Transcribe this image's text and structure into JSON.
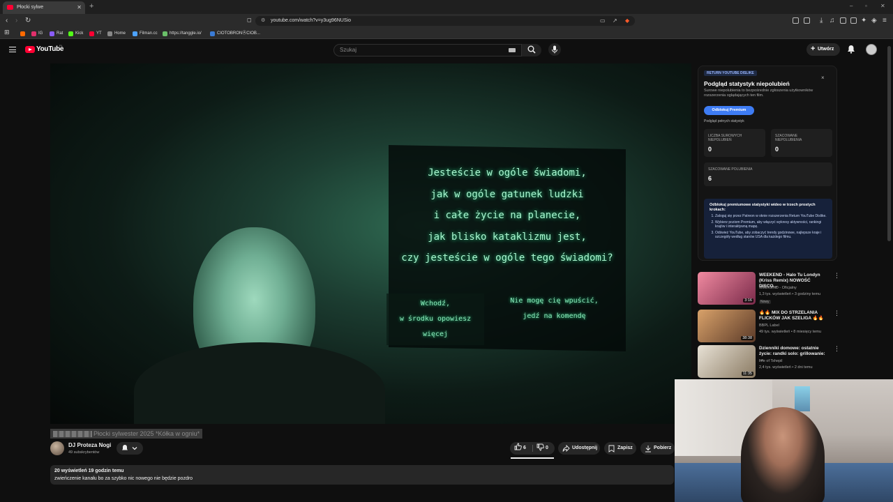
{
  "browser": {
    "tab_title": "Płocki sylwe",
    "url": "youtube.com/watch?v=y3ug96NUSio"
  },
  "bookmarks": [
    {
      "label": "IG",
      "color": "#e1306c"
    },
    {
      "label": "Rat",
      "color": "#8a5cf6"
    },
    {
      "label": "Kick",
      "color": "#53fc18"
    },
    {
      "label": "YT",
      "color": "#ff0033"
    },
    {
      "label": "Home",
      "color": "#888888"
    },
    {
      "label": "Filman.cc",
      "color": "#4da3ff"
    },
    {
      "label": "https://tanggle.io/",
      "color": "#6abf69"
    },
    {
      "label": "CIOTOBRONⒶCIOB...",
      "color": "#3a7bd5"
    }
  ],
  "header": {
    "logo_text": "YouTube",
    "logo_region": "PL",
    "search_placeholder": "Szukaj",
    "create_label": "Utwórz"
  },
  "video": {
    "overlay_lines": [
      "Jesteście w ogóle świadomi,",
      "jak w ogóle gatunek ludzki",
      "i całe życie na planecie,",
      "jak blisko kataklizmu jest,",
      "czy jesteście w ogóle tego świadomi?"
    ],
    "choice_left": [
      "Wchodź,",
      "w środku opowiesz więcej"
    ],
    "choice_right": [
      "Nie mogę cię wpuścić,",
      "jedź na komendę"
    ],
    "title": "Płocki sylwester 2025 *Kółka w ogniu*"
  },
  "channel": {
    "name": "DJ Proteza Nogi",
    "subscribers": "49 subskrybentów"
  },
  "actions": {
    "likes": "6",
    "dislikes": "0",
    "share": "Udostępnij",
    "save": "Zapisz",
    "download": "Pobierz"
  },
  "description": {
    "stats": "20 wyświetleń  19 godzin temu",
    "text": "zwieńczenie kanału bo za szybko nic nowego nie będzie pozdro"
  },
  "ryd": {
    "badge": "RETURN YOUTUBE DISLIKE",
    "close": "×",
    "title": "Podgląd statystyk niepolubień",
    "subtitle": "Surowe niepolubienia to bezpośrednie zgłoszenia użytkowników rozszerzenia oglądających ten film.",
    "unlock_button": "Odblokuj Premium",
    "full_stats_link": "Podgląd pełnych statystyk",
    "stats": [
      {
        "label": "LICZBA SUROWYCH NIEPOLUBIEŃ",
        "value": "0"
      },
      {
        "label": "SZACOWANE NIEPOLUBIENIA",
        "value": "0"
      },
      {
        "label": "SZACOWANE POLUBIENIA",
        "value": "6"
      }
    ],
    "premium_heading": "Odblokuj premiumowe statystyki wideo w trzech prostych krokach:",
    "premium_steps": [
      "Zaloguj się przez Patreon w oknie rozszerzenia Return YouTube Dislike.",
      "Wybierz poziom Premium, aby włączyć wykresy aktywności, rankingi krajów i interaktywną mapę.",
      "Odśwież YouTube, aby zobaczyć trendy godzinowe, najlepsze kraje i szczegóły według stanów USA dla każdego filmu."
    ]
  },
  "recommendations": [
    {
      "title": "WEEKEND - Halo Tu Londyn (Kriss Remix) NOWOŚĆ DISCO...",
      "channel": "WEEKEND - Oficjalny",
      "meta": "1,3 tys. wyświetleń • 3 godziny temu",
      "badge": "Nowy",
      "duration": "3:16",
      "thumb_colors": [
        "#f08aa0",
        "#7a2a4a"
      ]
    },
    {
      "title": "🔥🔥 MIX DO STRZELANIA FLICKÓW JAK SZELIGA 🔥🔥",
      "channel": "BBPL Label",
      "meta": "49 tys. wyświetleń • 8 miesięcy temu",
      "badge": "",
      "duration": "38:38",
      "thumb_colors": [
        "#d9a26a",
        "#5b3a28"
      ]
    },
    {
      "title": "Dzienniki domowe: ostatnie życie: randki solo: grillowanie: ...",
      "channel": "Life of Tshepil",
      "meta": "2,4 tys. wyświetleń • 2 dni temu",
      "badge": "Nowy",
      "extra": "Z dubbingiem automaty...",
      "duration": "11:35",
      "thumb_colors": [
        "#e8e2d6",
        "#8a7a62"
      ]
    }
  ]
}
